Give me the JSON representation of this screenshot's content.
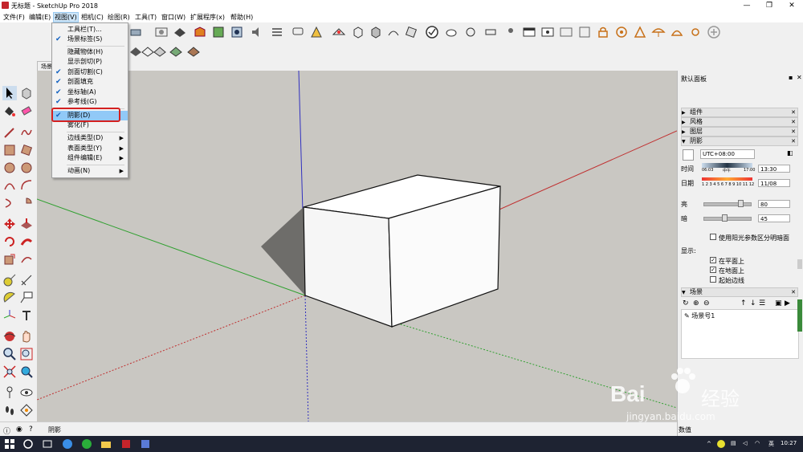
{
  "window": {
    "title": "无标题 - SketchUp Pro 2018",
    "minimize": "—",
    "maximize": "❐",
    "close": "✕"
  },
  "menubar": {
    "items": [
      "文件(F)",
      "编辑(E)",
      "视图(V)",
      "相机(C)",
      "绘图(R)",
      "工具(T)",
      "窗口(W)",
      "扩展程序(x)",
      "帮助(H)"
    ]
  },
  "view_menu": {
    "items": [
      {
        "label": "工具栏(T)...",
        "checked": false,
        "submenu": false
      },
      {
        "label": "场景标签(S)",
        "checked": true,
        "submenu": false
      },
      {
        "label": "隐藏物体(H)",
        "checked": false,
        "submenu": false
      },
      {
        "label": "显示剖切(P)",
        "checked": false,
        "submenu": false
      },
      {
        "label": "剖面切割(C)",
        "checked": true,
        "submenu": false
      },
      {
        "label": "剖面填充",
        "checked": true,
        "submenu": false
      },
      {
        "label": "坐标轴(A)",
        "checked": true,
        "submenu": false
      },
      {
        "label": "参考线(G)",
        "checked": true,
        "submenu": false
      },
      {
        "label": "阴影(D)",
        "checked": true,
        "submenu": false,
        "highlighted": true
      },
      {
        "label": "雾化(F)",
        "checked": false,
        "submenu": false
      },
      {
        "label": "边线类型(D)",
        "checked": false,
        "submenu": true
      },
      {
        "label": "表面类型(Y)",
        "checked": false,
        "submenu": true
      },
      {
        "label": "组件编辑(E)",
        "checked": false,
        "submenu": true
      },
      {
        "label": "动画(N)",
        "checked": false,
        "submenu": true
      }
    ]
  },
  "scene_tab": {
    "label": "场景"
  },
  "tray": {
    "title": "默认面板",
    "sections": {
      "components": "组件",
      "styles": "风格",
      "layers": "图层",
      "shadows": "阴影",
      "scenes": "场景"
    },
    "shadows": {
      "timezone": "UTC+08:00",
      "time_label": "时间",
      "time_start": "06:03",
      "time_noon": "中午",
      "time_end": "17:00",
      "time_value": "13:30",
      "date_label": "日期",
      "months": "1 2 3 4 5 6 7 8 9 10 11 12",
      "date_value": "11/08",
      "light_label": "亮",
      "light_value": "80",
      "light_level": 0.8,
      "dark_label": "暗",
      "dark_value": "45",
      "dark_level": 0.45,
      "sun_for_shading": "使用阳光参数区分明暗面",
      "display_label": "显示:",
      "on_faces": "在平面上",
      "on_faces_checked": true,
      "on_ground": "在地面上",
      "on_ground_checked": true,
      "from_edges": "起始边线",
      "from_edges_checked": false
    },
    "scenes": {
      "item": "场景号1"
    }
  },
  "status": {
    "text": "阴影",
    "measurements_label": "数值"
  },
  "taskbar": {
    "ime": "英",
    "clock": "10:27"
  },
  "watermark": {
    "brand": "Bai",
    "brand_cn": "经验",
    "url": "jingyan.baidu.com"
  },
  "colors": {
    "axis_red": "#c03030",
    "axis_green": "#30a030",
    "axis_blue": "#3030c0",
    "viewport_bg": "#c9c7c2",
    "highlight_box": "#d42020",
    "menu_highlight": "#91c9f7",
    "checkmark": "#1060c0"
  }
}
